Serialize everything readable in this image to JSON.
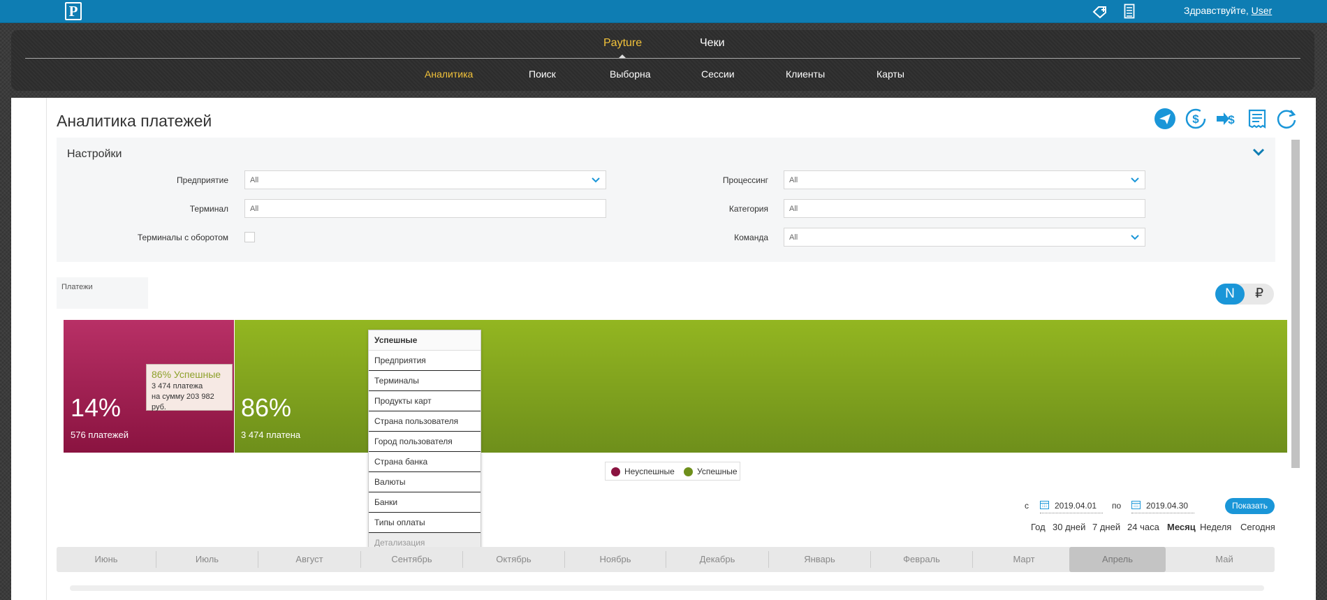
{
  "topbar": {
    "logo": "P",
    "greeting_prefix": "Здравствуйте, ",
    "user": "User",
    "icons": [
      "plus-card-icon",
      "document-icon"
    ]
  },
  "nav": {
    "top": [
      {
        "label": "Payture",
        "active": true
      },
      {
        "label": "Чеки",
        "active": false
      }
    ],
    "bottom": [
      {
        "label": "Аналитика",
        "active": true
      },
      {
        "label": "Поиск",
        "active": false
      },
      {
        "label": "Выборна",
        "active": false
      },
      {
        "label": "Сессии",
        "active": false
      },
      {
        "label": "Клиенты",
        "active": false
      },
      {
        "label": "Карты",
        "active": false
      }
    ]
  },
  "page": {
    "title": "Аналитика платежей",
    "actions": [
      "send-icon",
      "dollar-refresh-icon",
      "dollar-transfer-icon",
      "receipt-icon",
      "refresh-icon"
    ]
  },
  "settings": {
    "title": "Настройки",
    "fields": {
      "enterprise": {
        "label": "Предприятие",
        "value": "All"
      },
      "terminal": {
        "label": "Терминал",
        "value": "All"
      },
      "turnover": {
        "label": "Терминалы с оборотом"
      },
      "processing": {
        "label": "Процессинг",
        "value": "All"
      },
      "category": {
        "label": "Категория",
        "value": "All"
      },
      "command": {
        "label": "Команда",
        "value": "All"
      }
    }
  },
  "tile": {
    "label": "Платежи"
  },
  "toggle": {
    "count": "N",
    "currency": "₽"
  },
  "chart_data": {
    "type": "bar",
    "orientation": "horizontal-stacked-100",
    "categories": [
      "Неуспешные",
      "Успешные"
    ],
    "series": [
      {
        "name": "Неуспешные",
        "percent": 14,
        "count_label": "576 платежей",
        "color": "#8a1340"
      },
      {
        "name": "Успешные",
        "percent": 86,
        "count_label": "3 474 платена",
        "color": "#6e8f1b"
      }
    ],
    "labels": {
      "fail_pct": "14%",
      "ok_pct": "86%"
    }
  },
  "tooltip": {
    "title": "86% Успешные",
    "line1": "3 474 платежа",
    "line2": "на сумму 203 982 руб."
  },
  "menu": {
    "header": "Успешные",
    "items": [
      "Предприятия",
      "Терминалы",
      "Продукты карт",
      "Страна пользователя",
      "Город пользователя",
      "Страна банка",
      "Валюты",
      "Банки",
      "Типы оплаты"
    ],
    "disabled": "Детализация"
  },
  "legend": {
    "fail": "Неуспешные",
    "ok": "Успешные"
  },
  "dates": {
    "from_label": "с",
    "from": "2019.04.01",
    "to_label": "по",
    "to": "2019.04.30",
    "show": "Показать"
  },
  "periods": [
    {
      "label": "Год",
      "active": false
    },
    {
      "label": "30 дней",
      "active": false
    },
    {
      "label": "7 дней",
      "active": false
    },
    {
      "label": "24 часа",
      "active": false
    },
    {
      "label": "Месяц",
      "active": true
    },
    {
      "label": "Неделя",
      "active": false
    },
    {
      "label": "Сегодня",
      "active": false
    }
  ],
  "months": [
    {
      "label": "Июнь",
      "active": false
    },
    {
      "label": "Июль",
      "active": false
    },
    {
      "label": "Август",
      "active": false
    },
    {
      "label": "Сентябрь",
      "active": false
    },
    {
      "label": "Октябрь",
      "active": false
    },
    {
      "label": "Ноябрь",
      "active": false
    },
    {
      "label": "Декабрь",
      "active": false
    },
    {
      "label": "Январь",
      "active": false
    },
    {
      "label": "Февраль",
      "active": false
    },
    {
      "label": "Март",
      "active": false
    },
    {
      "label": "Апрель",
      "active": true
    },
    {
      "label": "Май",
      "active": false
    }
  ],
  "colors": {
    "accent": "#1a96d8",
    "topbar": "#0e7db3",
    "nav_active": "#f2c23a",
    "fail": "#8a1340",
    "ok": "#6e8f1b"
  }
}
